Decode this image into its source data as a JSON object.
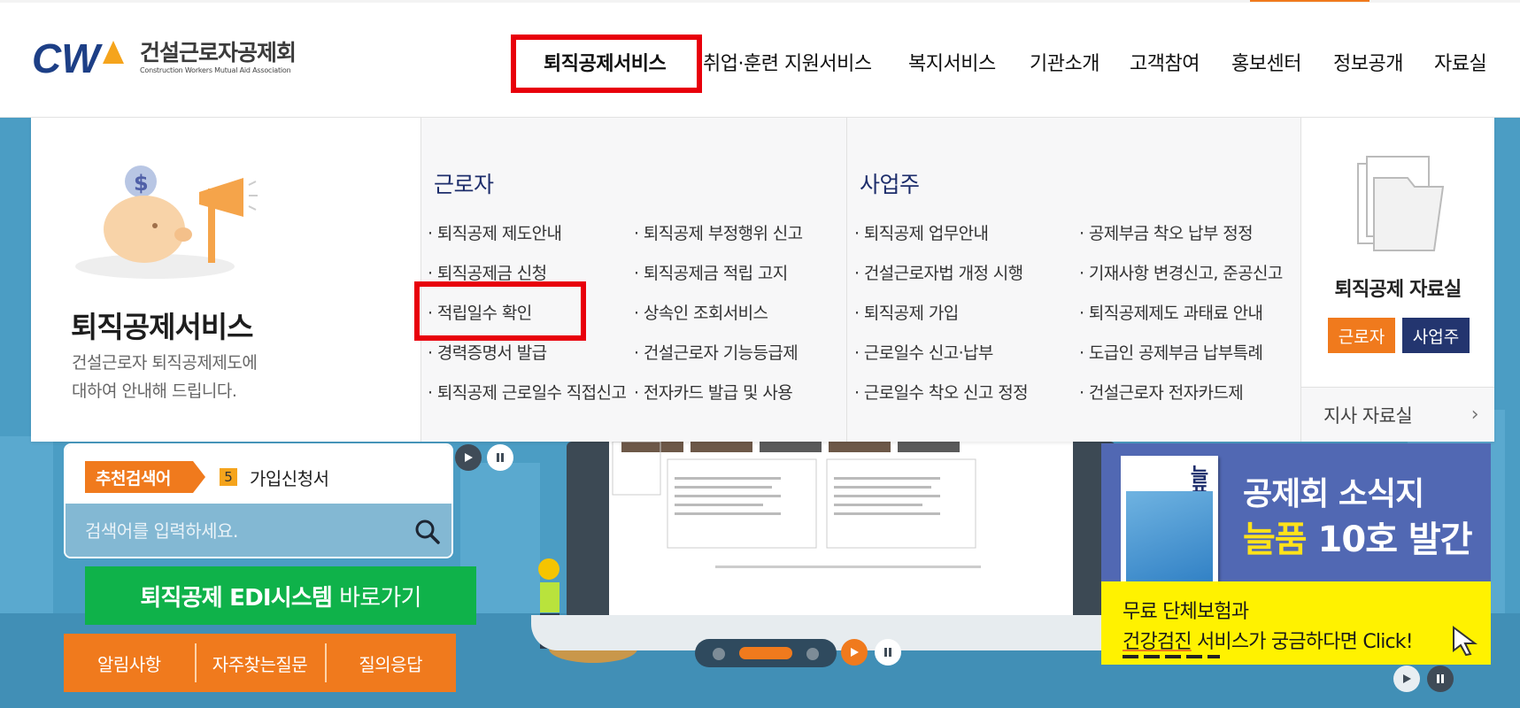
{
  "site": {
    "logo_ko": "건설근로자공제회",
    "logo_en": "Construction Workers Mutual Aid Association"
  },
  "gnb": [
    {
      "label": "퇴직공제서비스"
    },
    {
      "label": "취업·훈련 지원서비스"
    },
    {
      "label": "복지서비스"
    },
    {
      "label": "기관소개"
    },
    {
      "label": "고객참여"
    },
    {
      "label": "홍보센터"
    },
    {
      "label": "정보공개"
    },
    {
      "label": "자료실"
    }
  ],
  "mega": {
    "title": "퇴직공제서비스",
    "desc_line1": "건설근로자 퇴직공제제도에",
    "desc_line2": "대하여 안내해 드립니다.",
    "worker": {
      "title": "근로자",
      "left": [
        "· 퇴직공제 제도안내",
        "· 퇴직공제금 신청",
        "· 적립일수 확인",
        "· 경력증명서 발급",
        "· 퇴직공제 근로일수 직접신고"
      ],
      "right": [
        "· 퇴직공제 부정행위 신고",
        "· 퇴직공제금 적립 고지",
        "· 상속인 조회서비스",
        "· 건설근로자 기능등급제",
        "· 전자카드 발급 및 사용"
      ]
    },
    "employer": {
      "title": "사업주",
      "left": [
        "· 퇴직공제 업무안내",
        "· 건설근로자법 개정 시행",
        "· 퇴직공제 가입",
        "· 근로일수 신고·납부",
        "· 근로일수 착오 신고 정정"
      ],
      "right": [
        "· 공제부금 착오 납부 정정",
        "· 기재사항 변경신고, 준공신고",
        "· 퇴직공제제도 과태료 안내",
        "· 도급인 공제부금 납부특례",
        "· 건설근로자 전자카드제"
      ]
    },
    "library": {
      "title": "퇴직공제 자료실",
      "worker_btn": "근로자",
      "employer_btn": "사업주",
      "branch": "지사 자료실"
    }
  },
  "recommend": {
    "tag": "추천검색어",
    "rank": "5",
    "word": "가입신청서"
  },
  "search": {
    "placeholder": "검색어를 입력하세요."
  },
  "edi": {
    "bold": "퇴직공제 EDI시스템",
    "rest": "바로가기"
  },
  "quick": [
    "알림사항",
    "자주찾는질문",
    "질의응답"
  ],
  "banner": {
    "book_title": "늘품",
    "line1": "공제회 소식지",
    "line2_yellow": "늘품",
    "line2_rest": "10호 발간",
    "yellow_line1": "무료 단체보험과",
    "yellow_line2_u": "건강검진",
    "yellow_line2_rest": "서비스가 궁금하다면 Click!"
  },
  "colors": {
    "accent_orange": "#f07a1d",
    "navy": "#23356f",
    "green": "#0fb24a",
    "highlight_red": "#e8000b"
  }
}
